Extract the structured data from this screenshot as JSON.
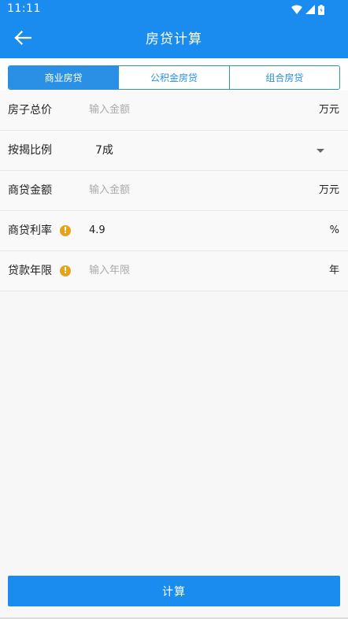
{
  "status_bar": {
    "time": "11:11"
  },
  "app_bar": {
    "title": "房贷计算"
  },
  "tabs": [
    {
      "label": "商业房贷",
      "active": true
    },
    {
      "label": "公积金房贷",
      "active": false
    },
    {
      "label": "组合房贷",
      "active": false
    }
  ],
  "form": {
    "total_price": {
      "label": "房子总价",
      "placeholder": "输入金额",
      "value": "",
      "unit": "万元"
    },
    "down_payment": {
      "label": "按揭比例",
      "selected": "7成"
    },
    "loan_amount": {
      "label": "商贷金额",
      "placeholder": "输入金额",
      "value": "",
      "unit": "万元"
    },
    "interest_rate": {
      "label": "商贷利率",
      "value": "4.9",
      "unit": "%"
    },
    "loan_term": {
      "label": "贷款年限",
      "placeholder": "输入年限",
      "value": "",
      "unit": "年"
    }
  },
  "calculate_button": {
    "label": "计算"
  },
  "colors": {
    "primary": "#1a8cef",
    "tab_border": "#2a90e6",
    "warning": "#e5a31c"
  }
}
